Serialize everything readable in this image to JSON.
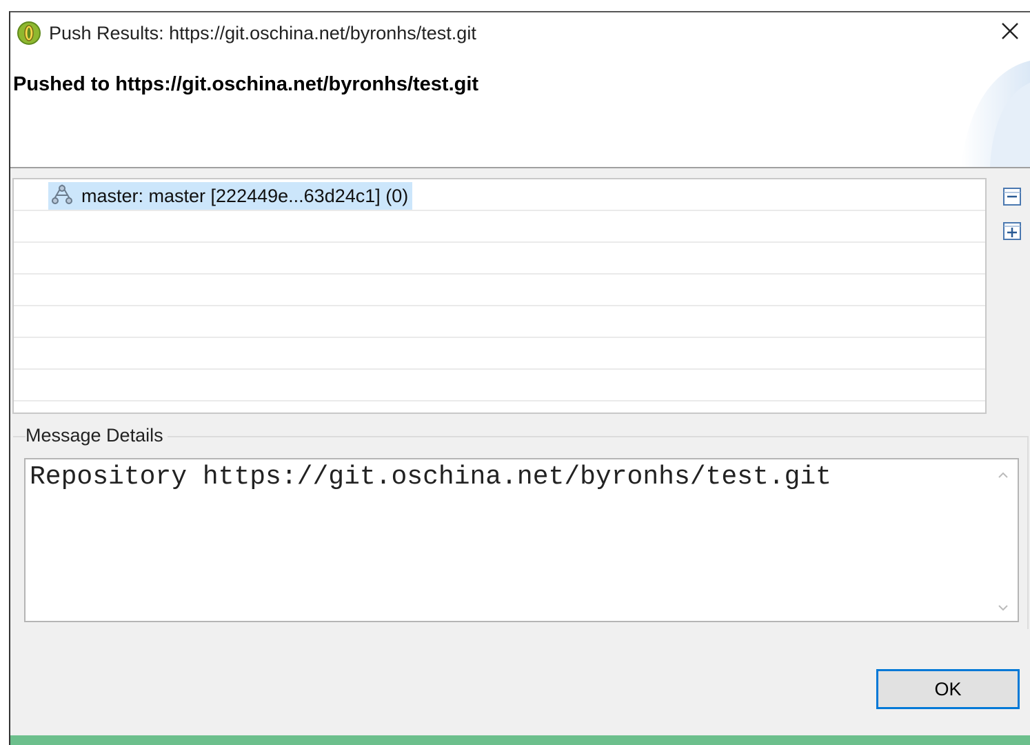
{
  "window": {
    "title": "Push Results: https://git.oschina.net/byronhs/test.git",
    "app_icon": "eclipse-icon",
    "close_icon": "close-icon"
  },
  "header": {
    "message": "Pushed to https://git.oschina.net/byronhs/test.git"
  },
  "tree": {
    "items": [
      {
        "icon": "branch-icon",
        "label": "master: master [222449e...63d24c1] (0)",
        "selected": true
      }
    ],
    "collapse_all_icon": "collapse-all-icon",
    "expand_all_icon": "expand-all-icon"
  },
  "details": {
    "label": "Message Details",
    "text": "Repository https://git.oschina.net/byronhs/test.git"
  },
  "buttons": {
    "ok_label": "OK"
  },
  "colors": {
    "selection": "#cce6fb",
    "ok_border": "#0078d7",
    "dialog_bg": "#f0f0f0"
  }
}
